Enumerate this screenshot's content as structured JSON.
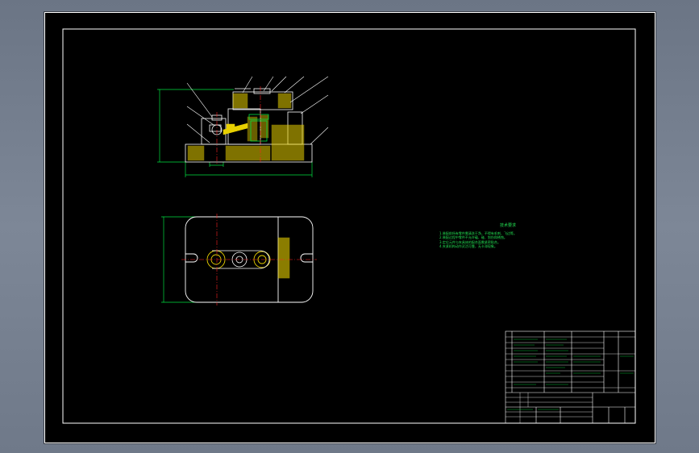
{
  "technical_requirements": {
    "title": "技术要求",
    "lines": [
      "1.装配前所有零件需清洗干净，不得有毛刺、飞边等。",
      "2.装配过程中零件不允许磕、碰、划伤和锈蚀。",
      "3.定位元件与夹具体的配合面需紧密贴合。",
      "4.夹紧机构动作灵活可靠，无卡滞现象。"
    ]
  },
  "colors": {
    "background": "#000000",
    "frame": "#ffffff",
    "outline": "#ffffff",
    "section": "#e8d000",
    "dimension": "#00e040",
    "centerline": "#ff2020",
    "text": "#22e052"
  }
}
